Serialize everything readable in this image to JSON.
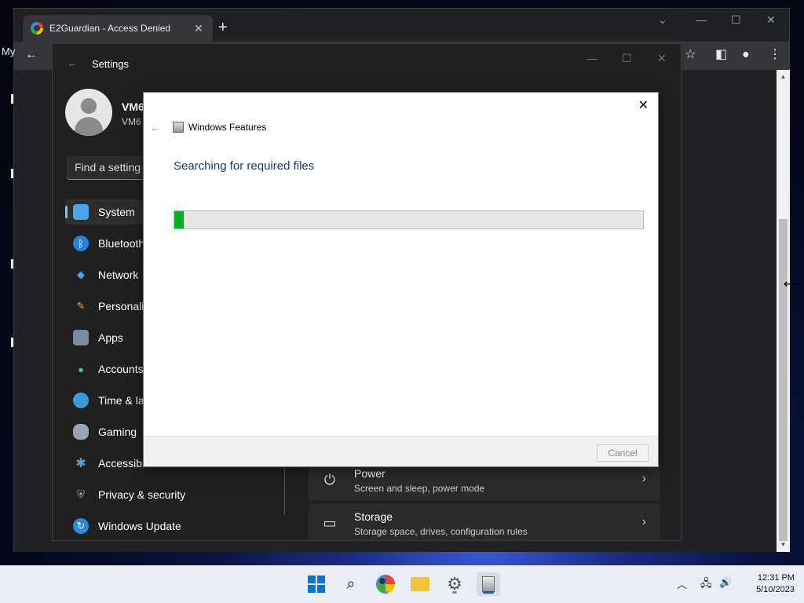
{
  "chrome": {
    "tab_title": "E2Guardian - Access Denied",
    "tab_close": "✕",
    "new_tab": "+",
    "bookmark_label": "My"
  },
  "settings": {
    "window_title": "Settings",
    "user_name": "VM6",
    "user_sub": "VM6",
    "search_placeholder": "Find a setting",
    "nav": [
      {
        "label": "System",
        "icon": "system-icon"
      },
      {
        "label": "Bluetooth",
        "icon": "bluetooth-icon"
      },
      {
        "label": "Network",
        "icon": "network-icon"
      },
      {
        "label": "Personali",
        "icon": "personalization-icon"
      },
      {
        "label": "Apps",
        "icon": "apps-icon"
      },
      {
        "label": "Accounts",
        "icon": "accounts-icon"
      },
      {
        "label": "Time & la",
        "icon": "time-icon"
      },
      {
        "label": "Gaming",
        "icon": "gaming-icon"
      },
      {
        "label": "Accessibi",
        "icon": "accessibility-icon"
      },
      {
        "label": "Privacy & security",
        "icon": "privacy-shield-icon"
      },
      {
        "label": "Windows Update",
        "icon": "windows-update-icon"
      }
    ],
    "cards": [
      {
        "title": "Power",
        "subtitle": "Screen and sleep, power mode",
        "icon": "power-icon"
      },
      {
        "title": "Storage",
        "subtitle": "Storage space, drives, configuration rules",
        "icon": "storage-icon"
      }
    ]
  },
  "dialog": {
    "title": "Windows Features",
    "heading": "Searching for required files",
    "progress_fraction": 0.02,
    "cancel_label": "Cancel",
    "close": "✕"
  },
  "taskbar": {
    "time": "12:31 PM",
    "date": "5/10/2023"
  },
  "colors": {
    "progress_fill": "#06b025",
    "accent": "#60cdff",
    "heading": "#1e3a78"
  }
}
